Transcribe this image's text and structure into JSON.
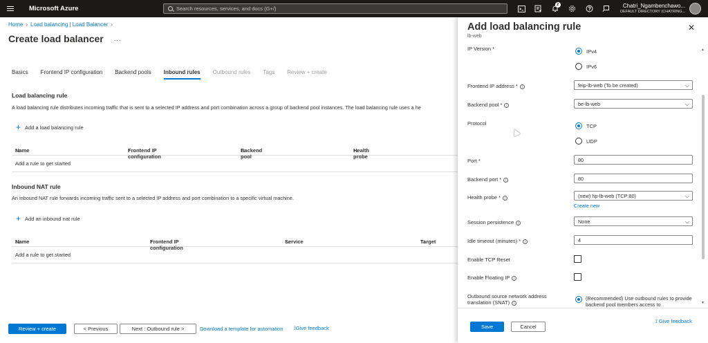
{
  "topbar": {
    "brand": "Microsoft Azure",
    "search_placeholder": "Search resources, services, and docs (G+/)",
    "notification_count": "2",
    "user_name": "Chatri_Ngambenchawo...",
    "user_directory": "DEFAULT DIRECTORY (CHATRING...",
    "icons": [
      "cloud-shell-icon",
      "directory-filter-icon",
      "notifications-icon",
      "settings-icon",
      "help-icon",
      "feedback-icon"
    ]
  },
  "breadcrumb": {
    "home": "Home",
    "parent": "Load balancing | Load Balancer"
  },
  "page": {
    "title": "Create load balancer",
    "more": "..."
  },
  "tabs": [
    {
      "label": "Basics",
      "state": "normal"
    },
    {
      "label": "Frontend IP configuration",
      "state": "normal"
    },
    {
      "label": "Backend pools",
      "state": "normal"
    },
    {
      "label": "Inbound rules",
      "state": "active"
    },
    {
      "label": "Outbound rules",
      "state": "disabled"
    },
    {
      "label": "Tags",
      "state": "disabled"
    },
    {
      "label": "Review + create",
      "state": "disabled"
    }
  ],
  "lb_rule_section": {
    "title": "Load balancing rule",
    "description": "A load balancing rule distributes incoming traffic that is sent to a selected IP address and port combination across a group of backend pool instances. The load balancing rule uses a he",
    "add_label": "Add a load balancing rule",
    "columns": [
      "Name",
      "Frontend IP configuration",
      "Backend pool",
      "Health probe"
    ],
    "empty": "Add a rule to get started"
  },
  "nat_section": {
    "title": "Inbound NAT rule",
    "description": "An inbound NAT rule forwards incoming traffic sent to a selected IP address and port combination to a specific virtual machine.",
    "add_label": "Add an inbound nat rule",
    "columns": [
      "Name",
      "Frontend IP configuration",
      "Service",
      "Target"
    ],
    "empty": "Add a rule to get started"
  },
  "sort_glyph": "↑↓",
  "bottombar": {
    "review_create": "Review + create",
    "previous": "< Previous",
    "next": "Next : Outbound rule >",
    "download_template": "Download a template for automation",
    "give_feedback": "Give feedback"
  },
  "panel": {
    "title": "Add load balancing rule",
    "subtitle": "lb-web",
    "ip_version_label": "IP Version *",
    "ipv4": "IPv4",
    "ipv6": "IPv6",
    "ip_version_selected": "IPv4",
    "frontend_ip_label": "Frontend IP address *",
    "frontend_ip_value": "feip-lb-web (To be created)",
    "backend_pool_label": "Backend pool *",
    "backend_pool_value": "be-lb-web",
    "protocol_label": "Protocol",
    "tcp": "TCP",
    "udp": "UDP",
    "protocol_selected": "TCP",
    "port_label": "Port *",
    "port_value": "80",
    "backend_port_label": "Backend port *",
    "backend_port_value": "80",
    "health_probe_label": "Health probe *",
    "health_probe_value": "(new) hp-lb-web (TCP:80)",
    "create_new": "Create new",
    "session_persistence_label": "Session persistence",
    "session_persistence_value": "None",
    "idle_timeout_label": "Idle timeout (minutes) *",
    "idle_timeout_value": "4",
    "tcp_reset_label": "Enable TCP Reset",
    "tcp_reset_checked": false,
    "floating_ip_label": "Enable Floating IP",
    "floating_ip_checked": false,
    "snat_label_1": "Outbound source network address",
    "snat_label_2": "translation (SNAT)",
    "snat_option": "(Recommended) Use outbound rules to provide backend pool members access to",
    "save": "Save",
    "cancel": "Cancel",
    "give_feedback": "Give feedback"
  }
}
